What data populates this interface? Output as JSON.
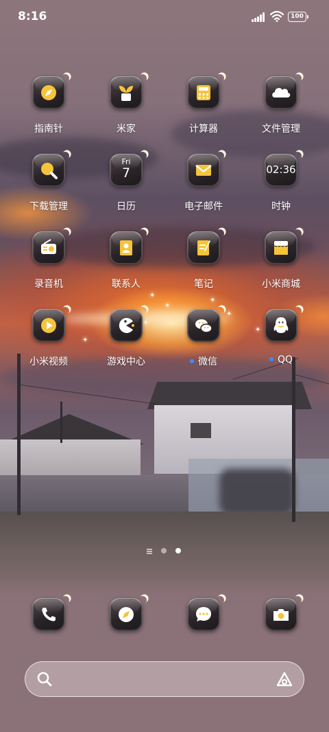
{
  "status_bar": {
    "time": "8:16",
    "battery": "100",
    "icons": [
      "signal-icon",
      "wifi-icon",
      "battery-icon"
    ]
  },
  "apps": [
    {
      "label": "指南针",
      "icon": "compass-icon"
    },
    {
      "label": "米家",
      "icon": "mijia-sprout-icon"
    },
    {
      "label": "计算器",
      "icon": "calculator-icon"
    },
    {
      "label": "文件管理",
      "icon": "cloud-folder-icon"
    },
    {
      "label": "下载管理",
      "icon": "download-magnifier-icon"
    },
    {
      "label": "日历",
      "icon": "calendar-icon",
      "day": "Fri",
      "date": "7"
    },
    {
      "label": "电子邮件",
      "icon": "mail-icon"
    },
    {
      "label": "时钟",
      "icon": "clock-icon",
      "clock_time": "02:36"
    },
    {
      "label": "录音机",
      "icon": "recorder-icon"
    },
    {
      "label": "联系人",
      "icon": "contacts-icon"
    },
    {
      "label": "笔记",
      "icon": "notes-icon"
    },
    {
      "label": "小米商城",
      "icon": "mi-store-icon"
    },
    {
      "label": "小米视频",
      "icon": "video-play-icon"
    },
    {
      "label": "游戏中心",
      "icon": "game-center-icon"
    },
    {
      "label": "微信",
      "icon": "wechat-icon",
      "has_notification": true
    },
    {
      "label": "QQ",
      "icon": "qq-penguin-icon",
      "has_notification": true
    }
  ],
  "page_indicator": {
    "pages": 2,
    "active_page": 2
  },
  "dock": [
    {
      "name": "phone",
      "icon": "phone-icon"
    },
    {
      "name": "browser",
      "icon": "browser-compass-icon"
    },
    {
      "name": "messages",
      "icon": "message-icon"
    },
    {
      "name": "camera",
      "icon": "camera-icon"
    }
  ],
  "search_bar": {
    "icons": [
      "search-icon",
      "assistant-icon"
    ]
  },
  "colors": {
    "icon_accent": "#f5c43a",
    "notification_dot": "#3d8bff",
    "label": "#ffffff"
  }
}
